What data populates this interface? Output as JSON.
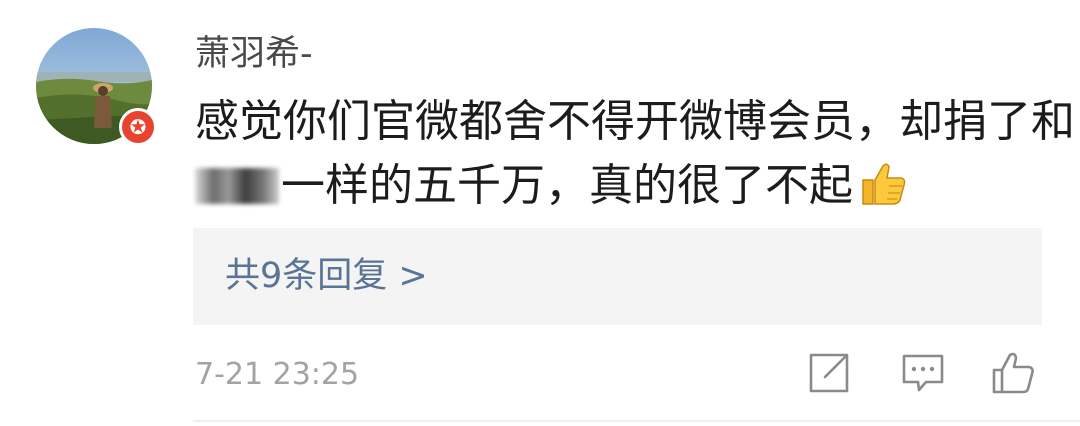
{
  "comment": {
    "username": "萧羽希-",
    "text_line1": "感觉你们官微都舍不得开微博会员，却捐了和",
    "text_line2": "一样的五千万，真的很了不起",
    "avatar_badge": "✪",
    "emoji": "thumbs-up-emoji",
    "badge_color": "#e8432e"
  },
  "replies": {
    "label": "共9条回复 >"
  },
  "meta": {
    "timestamp": "7-21 23:25"
  },
  "actions": [
    {
      "icon": "share-icon"
    },
    {
      "icon": "comment-icon"
    },
    {
      "icon": "like-icon"
    }
  ],
  "colors": {
    "username": "#4a4a4a",
    "text": "#1c1c1c",
    "link": "#5a7495",
    "timestamp": "#a3a3a3",
    "reply_bg": "#f4f4f4"
  }
}
